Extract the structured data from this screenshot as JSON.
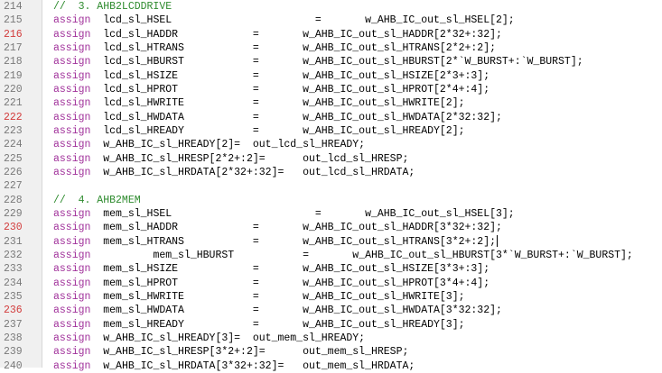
{
  "editor": {
    "lines": [
      {
        "n": "214",
        "hl": false,
        "kind": "comment",
        "text": "//  3. AHB2LCDDRIVE"
      },
      {
        "n": "215",
        "hl": false,
        "kind": "assign",
        "text": "lcd_sl_HSEL                       =       w_AHB_IC_out_sl_HSEL[2];"
      },
      {
        "n": "216",
        "hl": true,
        "kind": "assign",
        "text": "lcd_sl_HADDR            =       w_AHB_IC_out_sl_HADDR[2*32+:32];"
      },
      {
        "n": "217",
        "hl": false,
        "kind": "assign",
        "text": "lcd_sl_HTRANS           =       w_AHB_IC_out_sl_HTRANS[2*2+:2];"
      },
      {
        "n": "218",
        "hl": false,
        "kind": "assign",
        "text": "lcd_sl_HBURST           =       w_AHB_IC_out_sl_HBURST[2*`W_BURST+:`W_BURST];"
      },
      {
        "n": "219",
        "hl": false,
        "kind": "assign",
        "text": "lcd_sl_HSIZE            =       w_AHB_IC_out_sl_HSIZE[2*3+:3];"
      },
      {
        "n": "220",
        "hl": false,
        "kind": "assign",
        "text": "lcd_sl_HPROT            =       w_AHB_IC_out_sl_HPROT[2*4+:4];"
      },
      {
        "n": "221",
        "hl": false,
        "kind": "assign",
        "text": "lcd_sl_HWRITE           =       w_AHB_IC_out_sl_HWRITE[2];"
      },
      {
        "n": "222",
        "hl": true,
        "kind": "assign",
        "text": "lcd_sl_HWDATA           =       w_AHB_IC_out_sl_HWDATA[2*32:32];"
      },
      {
        "n": "223",
        "hl": false,
        "kind": "assign",
        "text": "lcd_sl_HREADY           =       w_AHB_IC_out_sl_HREADY[2];"
      },
      {
        "n": "224",
        "hl": false,
        "kind": "assign",
        "text": "w_AHB_IC_sl_HREADY[2]=  out_lcd_sl_HREADY;"
      },
      {
        "n": "225",
        "hl": false,
        "kind": "assign",
        "text": "w_AHB_IC_sl_HRESP[2*2+:2]=      out_lcd_sl_HRESP;"
      },
      {
        "n": "226",
        "hl": false,
        "kind": "assign",
        "text": "w_AHB_IC_sl_HRDATA[2*32+:32]=   out_lcd_sl_HRDATA;"
      },
      {
        "n": "227",
        "hl": false,
        "kind": "blank",
        "text": ""
      },
      {
        "n": "228",
        "hl": false,
        "kind": "comment",
        "text": "//  4. AHB2MEM"
      },
      {
        "n": "229",
        "hl": false,
        "kind": "assign",
        "text": "mem_sl_HSEL                       =       w_AHB_IC_out_sl_HSEL[3];"
      },
      {
        "n": "230",
        "hl": true,
        "kind": "assign",
        "text": "mem_sl_HADDR            =       w_AHB_IC_out_sl_HADDR[3*32+:32];"
      },
      {
        "n": "231",
        "hl": false,
        "kind": "assign",
        "caret": true,
        "text": "mem_sl_HTRANS           =       w_AHB_IC_out_sl_HTRANS[3*2+:2];"
      },
      {
        "n": "232",
        "hl": false,
        "kind": "assign",
        "text": "        mem_sl_HBURST           =       w_AHB_IC_out_sl_HBURST[3*`W_BURST+:`W_BURST];"
      },
      {
        "n": "233",
        "hl": false,
        "kind": "assign",
        "text": "mem_sl_HSIZE            =       w_AHB_IC_out_sl_HSIZE[3*3+:3];"
      },
      {
        "n": "234",
        "hl": false,
        "kind": "assign",
        "text": "mem_sl_HPROT            =       w_AHB_IC_out_sl_HPROT[3*4+:4];"
      },
      {
        "n": "235",
        "hl": false,
        "kind": "assign",
        "text": "mem_sl_HWRITE           =       w_AHB_IC_out_sl_HWRITE[3];"
      },
      {
        "n": "236",
        "hl": true,
        "kind": "assign",
        "text": "mem_sl_HWDATA           =       w_AHB_IC_out_sl_HWDATA[3*32:32];"
      },
      {
        "n": "237",
        "hl": false,
        "kind": "assign",
        "text": "mem_sl_HREADY           =       w_AHB_IC_out_sl_HREADY[3];"
      },
      {
        "n": "238",
        "hl": false,
        "kind": "assign",
        "text": "w_AHB_IC_sl_HREADY[3]=  out_mem_sl_HREADY;"
      },
      {
        "n": "239",
        "hl": false,
        "kind": "assign",
        "text": "w_AHB_IC_sl_HRESP[3*2+:2]=      out_mem_sl_HRESP;"
      },
      {
        "n": "240",
        "hl": false,
        "kind": "assign",
        "text": "w_AHB_IC_sl_HRDATA[3*32+:32]=   out_mem_sl_HRDATA;"
      }
    ],
    "keyword": "assign",
    "colors": {
      "keyword": "#a0309a",
      "comment": "#2e8b2e",
      "line_number": "#7a7a7a",
      "line_number_highlight": "#d23c3c",
      "gutter": "#f0f0f0"
    }
  }
}
